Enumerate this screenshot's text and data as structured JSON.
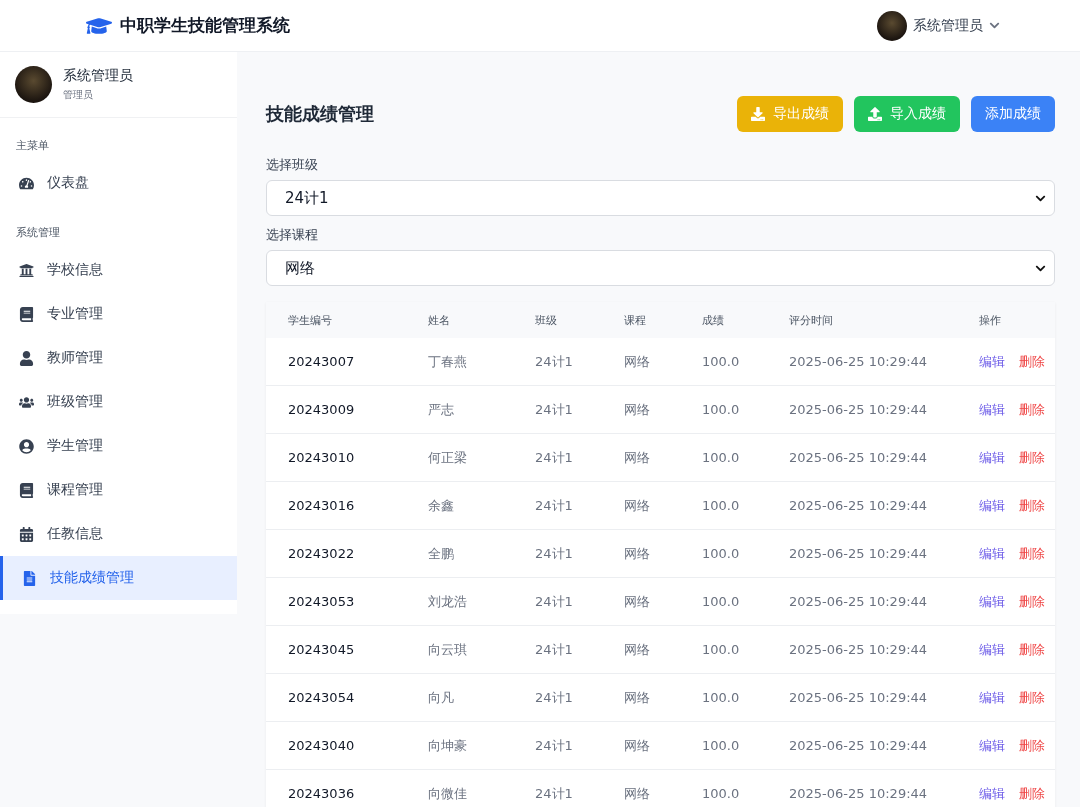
{
  "header": {
    "title": "中职学生技能管理系统",
    "user": "系统管理员"
  },
  "sidebar": {
    "profile": {
      "name": "系统管理员",
      "role": "管理员"
    },
    "sections": [
      {
        "title": "主菜单",
        "items": [
          {
            "label": "仪表盘",
            "selected": false
          }
        ]
      },
      {
        "title": "系统管理",
        "items": [
          {
            "label": "学校信息",
            "selected": false
          },
          {
            "label": "专业管理",
            "selected": false
          },
          {
            "label": "教师管理",
            "selected": false
          },
          {
            "label": "班级管理",
            "selected": false
          },
          {
            "label": "学生管理",
            "selected": false
          },
          {
            "label": "课程管理",
            "selected": false
          },
          {
            "label": "任教信息",
            "selected": false
          },
          {
            "label": "技能成绩管理",
            "selected": true
          }
        ]
      }
    ]
  },
  "page": {
    "title": "技能成绩管理",
    "buttons": [
      {
        "kind": "export",
        "label": "导出成绩"
      },
      {
        "kind": "import",
        "label": "导入成绩"
      },
      {
        "kind": "add",
        "label": "添加成绩"
      }
    ],
    "filters": [
      {
        "label": "选择班级",
        "value": "24计1"
      },
      {
        "label": "选择课程",
        "value": "网络"
      }
    ]
  },
  "table": {
    "columns": [
      "学生编号",
      "姓名",
      "班级",
      "课程",
      "成绩",
      "评分时间",
      "操作"
    ],
    "rows": [
      {
        "id": "20243007",
        "name": "丁春燕",
        "class": "24计1",
        "course": "网络",
        "score": "100.0",
        "time": "2025-06-25 10:29:44",
        "actions": [
          "编辑",
          "删除"
        ]
      },
      {
        "id": "20243009",
        "name": "严志",
        "class": "24计1",
        "course": "网络",
        "score": "100.0",
        "time": "2025-06-25 10:29:44",
        "actions": [
          "编辑",
          "删除"
        ]
      },
      {
        "id": "20243010",
        "name": "何正梁",
        "class": "24计1",
        "course": "网络",
        "score": "100.0",
        "time": "2025-06-25 10:29:44",
        "actions": [
          "编辑",
          "删除"
        ]
      },
      {
        "id": "20243016",
        "name": "余鑫",
        "class": "24计1",
        "course": "网络",
        "score": "100.0",
        "time": "2025-06-25 10:29:44",
        "actions": [
          "编辑",
          "删除"
        ]
      },
      {
        "id": "20243022",
        "name": "全鹏",
        "class": "24计1",
        "course": "网络",
        "score": "100.0",
        "time": "2025-06-25 10:29:44",
        "actions": [
          "编辑",
          "删除"
        ]
      },
      {
        "id": "20243053",
        "name": "刘龙浩",
        "class": "24计1",
        "course": "网络",
        "score": "100.0",
        "time": "2025-06-25 10:29:44",
        "actions": [
          "编辑",
          "删除"
        ]
      },
      {
        "id": "20243045",
        "name": "向云琪",
        "class": "24计1",
        "course": "网络",
        "score": "100.0",
        "time": "2025-06-25 10:29:44",
        "actions": [
          "编辑",
          "删除"
        ]
      },
      {
        "id": "20243054",
        "name": "向凡",
        "class": "24计1",
        "course": "网络",
        "score": "100.0",
        "time": "2025-06-25 10:29:44",
        "actions": [
          "编辑",
          "删除"
        ]
      },
      {
        "id": "20243040",
        "name": "向坤豪",
        "class": "24计1",
        "course": "网络",
        "score": "100.0",
        "time": "2025-06-25 10:29:44",
        "actions": [
          "编辑",
          "删除"
        ]
      },
      {
        "id": "20243036",
        "name": "向微佳",
        "class": "24计1",
        "course": "网络",
        "score": "100.0",
        "time": "2025-06-25 10:29:44",
        "actions": [
          "编辑",
          "删除"
        ]
      }
    ]
  }
}
